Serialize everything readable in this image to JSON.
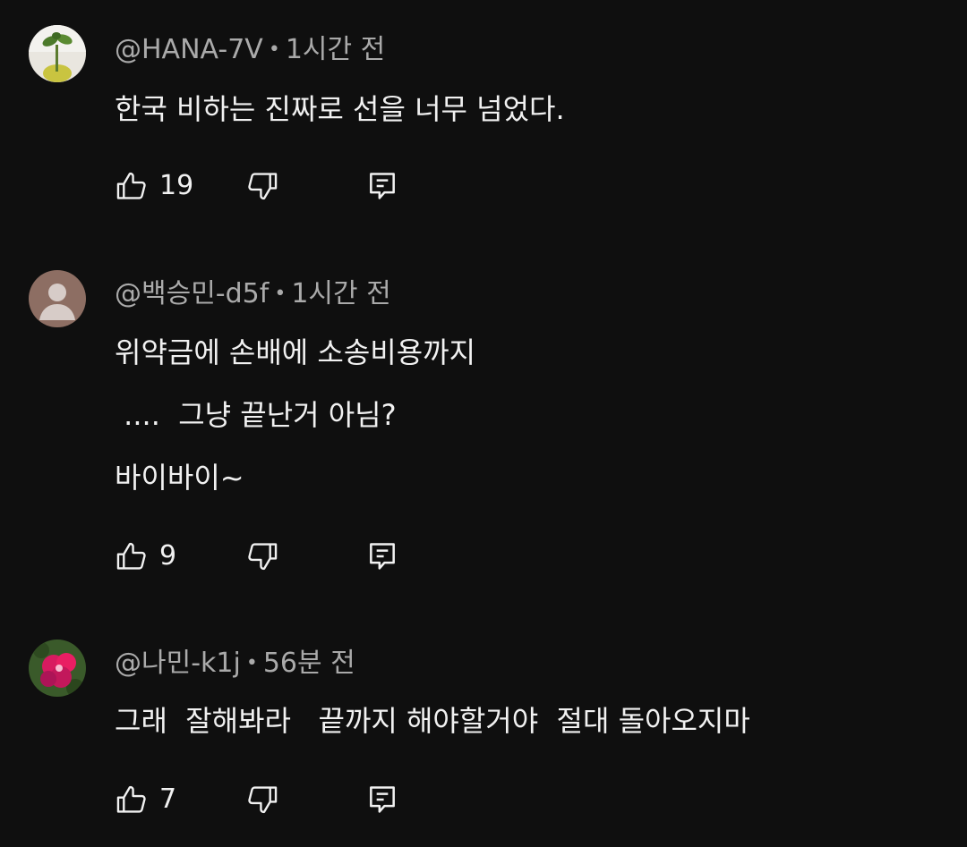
{
  "comments": [
    {
      "author": "@HANA-7V",
      "separator": "•",
      "time": "1시간 전",
      "lines": [
        "한국 비하는 진짜로 선을 너무 넘었다."
      ],
      "likes": "19",
      "avatar_icon": "plant-pot-photo"
    },
    {
      "author": "@백승민-d5f",
      "separator": "•",
      "time": "1시간 전",
      "lines": [
        "위약금에 손배에 소송비용까지",
        " ....  그냥 끝난거 아님?",
        "바이바이~"
      ],
      "likes": "9",
      "avatar_icon": "default-user-avatar"
    },
    {
      "author": "@나민-k1j",
      "separator": "•",
      "time": "56분 전",
      "lines": [
        "그래  잘해봐라   끝까지 해야할거야  절대 돌아오지마"
      ],
      "likes": "7",
      "avatar_icon": "pink-flower-photo"
    }
  ],
  "icons": {
    "like": "thumb-up-icon",
    "dislike": "thumb-down-icon",
    "reply": "reply-comment-icon"
  },
  "colors": {
    "background": "#0f0f0f",
    "text": "#f1f1f1",
    "meta_text": "#aaaaaa",
    "icon": "#f1f1f1"
  }
}
